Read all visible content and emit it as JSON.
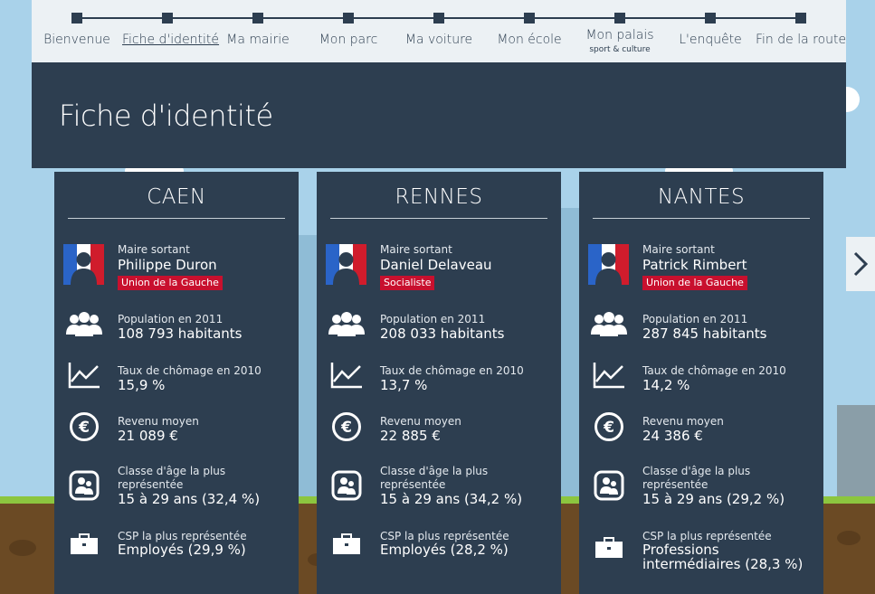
{
  "nav": {
    "steps": [
      {
        "label": "Bienvenue"
      },
      {
        "label": "Fiche d'identité",
        "active": true
      },
      {
        "label": "Ma mairie"
      },
      {
        "label": "Mon parc"
      },
      {
        "label": "Ma voiture"
      },
      {
        "label": "Mon école"
      },
      {
        "label": "Mon palais",
        "sublabel": "sport & culture"
      },
      {
        "label": "L'enquête"
      },
      {
        "label": "Fin de la route"
      }
    ]
  },
  "header": {
    "title": "Fiche d'identité"
  },
  "row_labels": {
    "mayor": "Maire sortant",
    "population": "Population en 2011",
    "unemployment": "Taux de chômage en 2010",
    "income": "Revenu moyen",
    "age": "Classe d'âge la plus représentée",
    "csp": "CSP la plus représentée"
  },
  "cities": [
    {
      "name": "CAEN",
      "mayor": "Philippe Duron",
      "party": "Union de la Gauche",
      "population": "108 793 habitants",
      "unemployment": "15,9 %",
      "income": "21 089 €",
      "age": "15 à 29 ans (32,4 %)",
      "csp": "Employés (29,9 %)"
    },
    {
      "name": "RENNES",
      "mayor": "Daniel Delaveau",
      "party": "Socialiste",
      "population": "208 033 habitants",
      "unemployment": "13,7 %",
      "income": "22 885 €",
      "age": "15 à 29 ans (34,2 %)",
      "csp": "Employés (28,2 %)"
    },
    {
      "name": "NANTES",
      "mayor": "Patrick Rimbert",
      "party": "Union de la Gauche",
      "population": "287 845 habitants",
      "unemployment": "14,2 %",
      "income": "24 386 €",
      "age": "15 à 29 ans (29,2 %)",
      "csp": "Professions intermédiaires (28,3 %)"
    }
  ],
  "icons": {
    "portrait": "mayor-portrait-icon",
    "population": "people-group-icon",
    "unemployment": "line-chart-icon",
    "income": "euro-icon",
    "age": "age-group-icon",
    "csp": "briefcase-icon",
    "next": "chevron-right-icon"
  },
  "colors": {
    "panel": "#2d3e50",
    "nav_bg": "#ecf1f4",
    "party": "#c8102e",
    "flag_blue": "#2a64c8",
    "flag_red": "#d01c2c",
    "sky": "#a9d2ea",
    "grass": "#8cc63f",
    "soil": "#6b4a24"
  }
}
